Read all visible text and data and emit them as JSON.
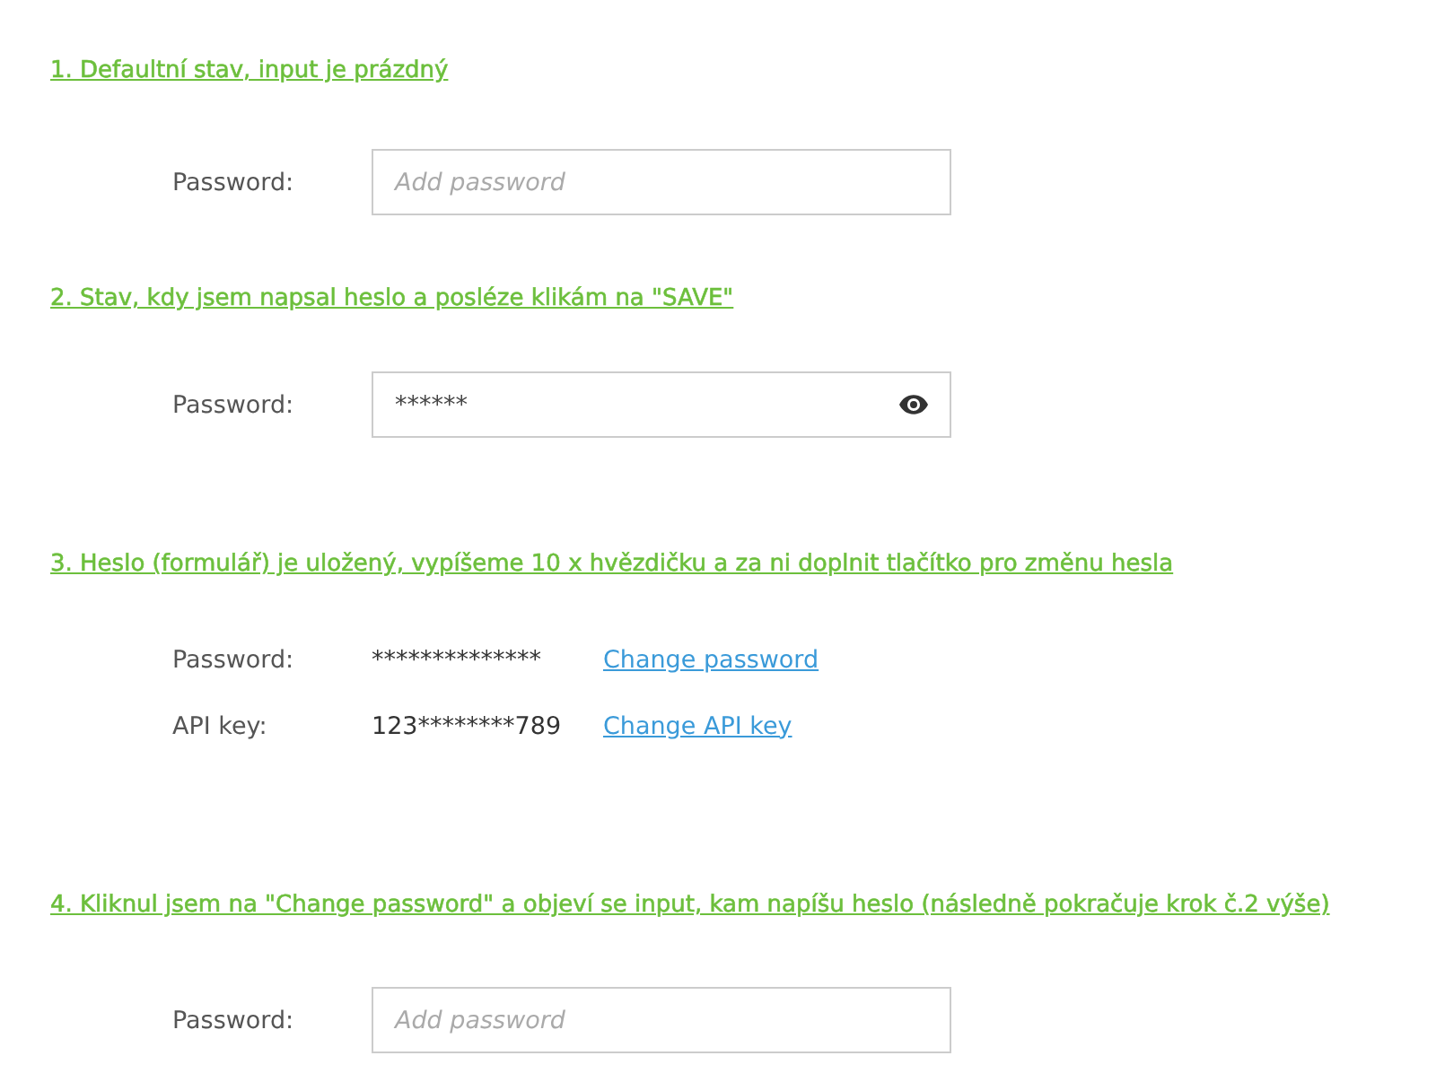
{
  "sections": [
    {
      "heading": "1. Defaultní stav, input je prázdný",
      "rows": [
        {
          "kind": "input",
          "label": "Password:",
          "placeholder": "Add password"
        }
      ]
    },
    {
      "heading": "2. Stav, kdy jsem napsal heslo a posléze klikám na \"SAVE\"",
      "rows": [
        {
          "kind": "input",
          "label": "Password:",
          "value": "******",
          "reveal_icon": true
        }
      ]
    },
    {
      "heading": "3. Heslo (formulář) je uložený, vypíšeme 10 x hvězdičku a za ni doplnit tlačítko pro změnu hesla",
      "rows": [
        {
          "kind": "stored",
          "label": "Password:",
          "value": "**************",
          "link": "Change password"
        },
        {
          "kind": "stored",
          "label": "API key:",
          "value": "123********789",
          "link": "Change API key"
        }
      ]
    },
    {
      "heading": "4. Kliknul jsem na \"Change password\" a objeví se input, kam napíšu heslo (následně pokračuje krok č.2 výše)",
      "rows": [
        {
          "kind": "input",
          "label": "Password:",
          "placeholder": "Add password"
        }
      ]
    }
  ]
}
